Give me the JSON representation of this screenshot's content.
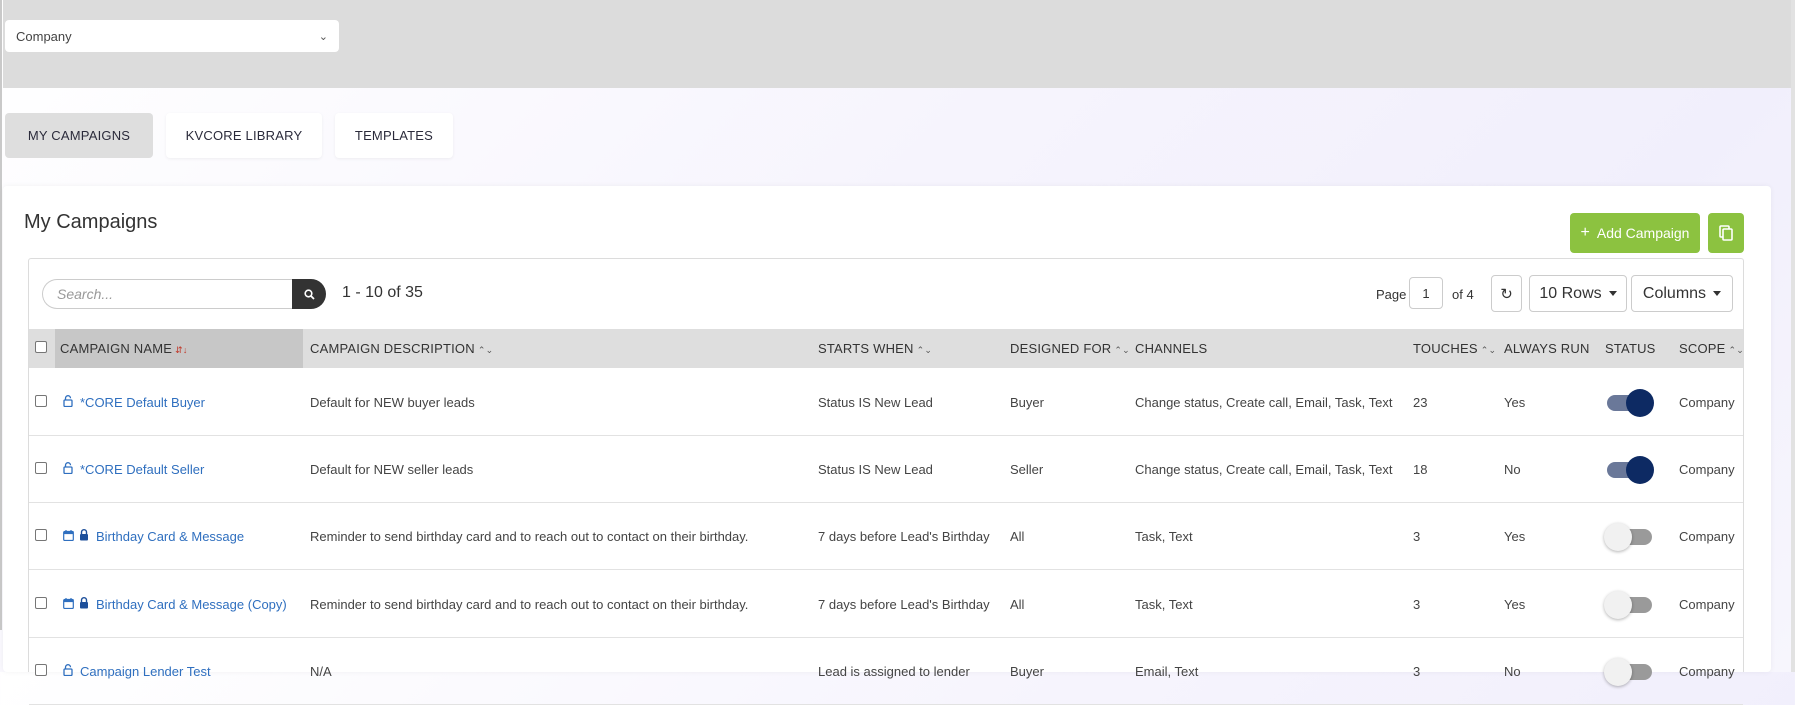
{
  "scope_select": {
    "value": "Company",
    "chevron_icon": "chevron-down-icon"
  },
  "tabs": [
    {
      "label": "MY CAMPAIGNS",
      "active": true
    },
    {
      "label": "KVCORE LIBRARY",
      "active": false
    },
    {
      "label": "TEMPLATES",
      "active": false
    }
  ],
  "card": {
    "title": "My Campaigns",
    "add_button": "Add Campaign",
    "add_icon": "+",
    "copy_icon": "copy-icon"
  },
  "toolbar": {
    "search_placeholder": "Search...",
    "search_icon": "search-icon",
    "range_text": "1 - 10 of 35",
    "page_label": "Page",
    "page_value": "1",
    "page_of": "of 4",
    "refresh_icon": "refresh-icon",
    "rows_label": "10 Rows",
    "columns_label": "Columns"
  },
  "columns": {
    "name": "CAMPAIGN NAME",
    "description": "CAMPAIGN DESCRIPTION",
    "starts": "STARTS WHEN",
    "designed": "DESIGNED FOR",
    "channels": "CHANNELS",
    "touches": "TOUCHES",
    "always": "ALWAYS RUN",
    "status": "STATUS",
    "scope": "SCOPE"
  },
  "sort_icons": {
    "sorted": "⇵↓",
    "sortable": "⌃⌄"
  },
  "rows": [
    {
      "icons": [
        "lock-open-icon"
      ],
      "name": "*CORE Default Buyer",
      "description": "Default for NEW buyer leads",
      "starts": "Status IS New Lead",
      "designed": "Buyer",
      "channels": "Change status, Create call, Email, Task, Text",
      "touches": "23",
      "always": "Yes",
      "status_on": true,
      "scope": "Company"
    },
    {
      "icons": [
        "lock-open-icon"
      ],
      "name": "*CORE Default Seller",
      "description": "Default for NEW seller leads",
      "starts": "Status IS New Lead",
      "designed": "Seller",
      "channels": "Change status, Create call, Email, Task, Text",
      "touches": "18",
      "always": "No",
      "status_on": true,
      "scope": "Company"
    },
    {
      "icons": [
        "calendar-icon",
        "lock-icon"
      ],
      "name": "Birthday Card & Message",
      "description": "Reminder to send birthday card and to reach out to contact on their birthday.",
      "starts": "7 days before Lead's Birthday",
      "designed": "All",
      "channels": "Task, Text",
      "touches": "3",
      "always": "Yes",
      "status_on": false,
      "scope": "Company"
    },
    {
      "icons": [
        "calendar-icon",
        "lock-icon"
      ],
      "name": "Birthday Card & Message (Copy)",
      "description": "Reminder to send birthday card and to reach out to contact on their birthday.",
      "starts": "7 days before Lead's Birthday",
      "designed": "All",
      "channels": "Task, Text",
      "touches": "3",
      "always": "Yes",
      "status_on": false,
      "scope": "Company"
    },
    {
      "icons": [
        "lock-open-icon"
      ],
      "name": "Campaign Lender Test",
      "description": "N/A",
      "starts": "Lead is assigned to lender",
      "designed": "Buyer",
      "channels": "Email, Text",
      "touches": "3",
      "always": "No",
      "status_on": false,
      "scope": "Company"
    }
  ]
}
